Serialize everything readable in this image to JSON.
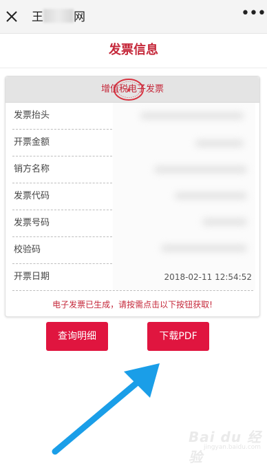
{
  "topbar": {
    "title_prefix": "王",
    "title_suffix": "网",
    "more_label": "•••",
    "close_icon": "close-icon",
    "more_icon": "more-horizontal-icon"
  },
  "page": {
    "title": "发票信息"
  },
  "invoice": {
    "header_text": "增值税电子发票",
    "seal_icon": "red-seal-stamp",
    "fields": [
      {
        "label": "发票抬头",
        "value": ""
      },
      {
        "label": "开票金额",
        "value": ""
      },
      {
        "label": "销方名称",
        "value": ""
      },
      {
        "label": "发票代码",
        "value": ""
      },
      {
        "label": "发票号码",
        "value": ""
      },
      {
        "label": "校验码",
        "value": ""
      },
      {
        "label": "开票日期",
        "value": "2018-02-11 12:54:52"
      }
    ],
    "notice": "电子发票已生成，请按需点击以下按钮获取!"
  },
  "actions": {
    "detail_label": "查询明细",
    "download_label": "下载PDF"
  },
  "watermark": {
    "text": "Bai du 经验",
    "sub": "jingyan.baidu.com"
  },
  "colors": {
    "accent": "#c5283a",
    "button": "#e0153f",
    "arrow": "#1a9ee8"
  }
}
